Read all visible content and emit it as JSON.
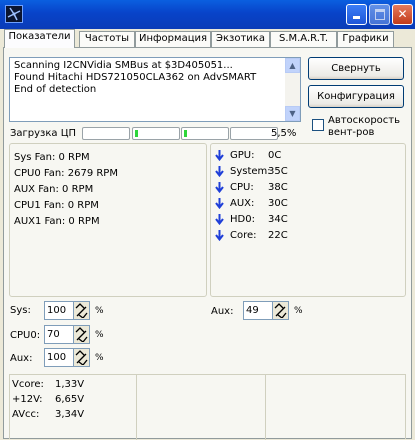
{
  "window": {
    "title": ""
  },
  "tabs": [
    {
      "label": "Показатели",
      "active": true
    },
    {
      "label": "Частоты"
    },
    {
      "label": "Информация"
    },
    {
      "label": "Экзотика"
    },
    {
      "label": "S.M.A.R.T."
    },
    {
      "label": "Графики"
    }
  ],
  "log": {
    "lines": [
      "Scanning I2CNVidia SMBus at $3D405051...",
      "Found Hitachi HDS721050CLA362 on AdvSMART",
      "End of detection"
    ]
  },
  "buttons": {
    "collapse": "Свернуть",
    "config": "Конфигурация"
  },
  "cpu": {
    "label": "Загрузка ЦП",
    "percent": "5,5%",
    "bars_filled": 0.055
  },
  "auto_fan": {
    "label_line1": "Автоскорость",
    "label_line2": "вент-ров",
    "checked": false
  },
  "fans": [
    {
      "name": "Sys Fan:",
      "value": "0 RPM"
    },
    {
      "name": "CPU0 Fan:",
      "value": "2679 RPM"
    },
    {
      "name": "AUX Fan:",
      "value": "0 RPM"
    },
    {
      "name": "CPU1 Fan:",
      "value": "0 RPM"
    },
    {
      "name": "AUX1 Fan:",
      "value": "0 RPM"
    }
  ],
  "temps": [
    {
      "name": "GPU:",
      "value": "0C"
    },
    {
      "name": "System:",
      "value": "35C"
    },
    {
      "name": "CPU:",
      "value": "38C"
    },
    {
      "name": "AUX:",
      "value": "30C"
    },
    {
      "name": "HD0:",
      "value": "34C"
    },
    {
      "name": "Core:",
      "value": "22C"
    }
  ],
  "speeds": {
    "sys": {
      "label": "Sys:",
      "value": "100",
      "unit": "%"
    },
    "cpu0": {
      "label": "CPU0:",
      "value": "70",
      "unit": "%"
    },
    "aux": {
      "label": "Aux:",
      "value": "100",
      "unit": "%"
    },
    "aux_right": {
      "label": "Aux:",
      "value": "49",
      "unit": "%"
    }
  },
  "voltages": [
    {
      "name": "Vcore:",
      "value": "1,33V"
    },
    {
      "name": "+12V:",
      "value": "6,65V"
    },
    {
      "name": "AVcc:",
      "value": "3,34V"
    }
  ],
  "colors": {
    "title_bar": "#0a5fe0",
    "arrow_blue": "#1f3fd8",
    "bar_green": "#2ed63a",
    "window_bg": "#ece9d8"
  }
}
